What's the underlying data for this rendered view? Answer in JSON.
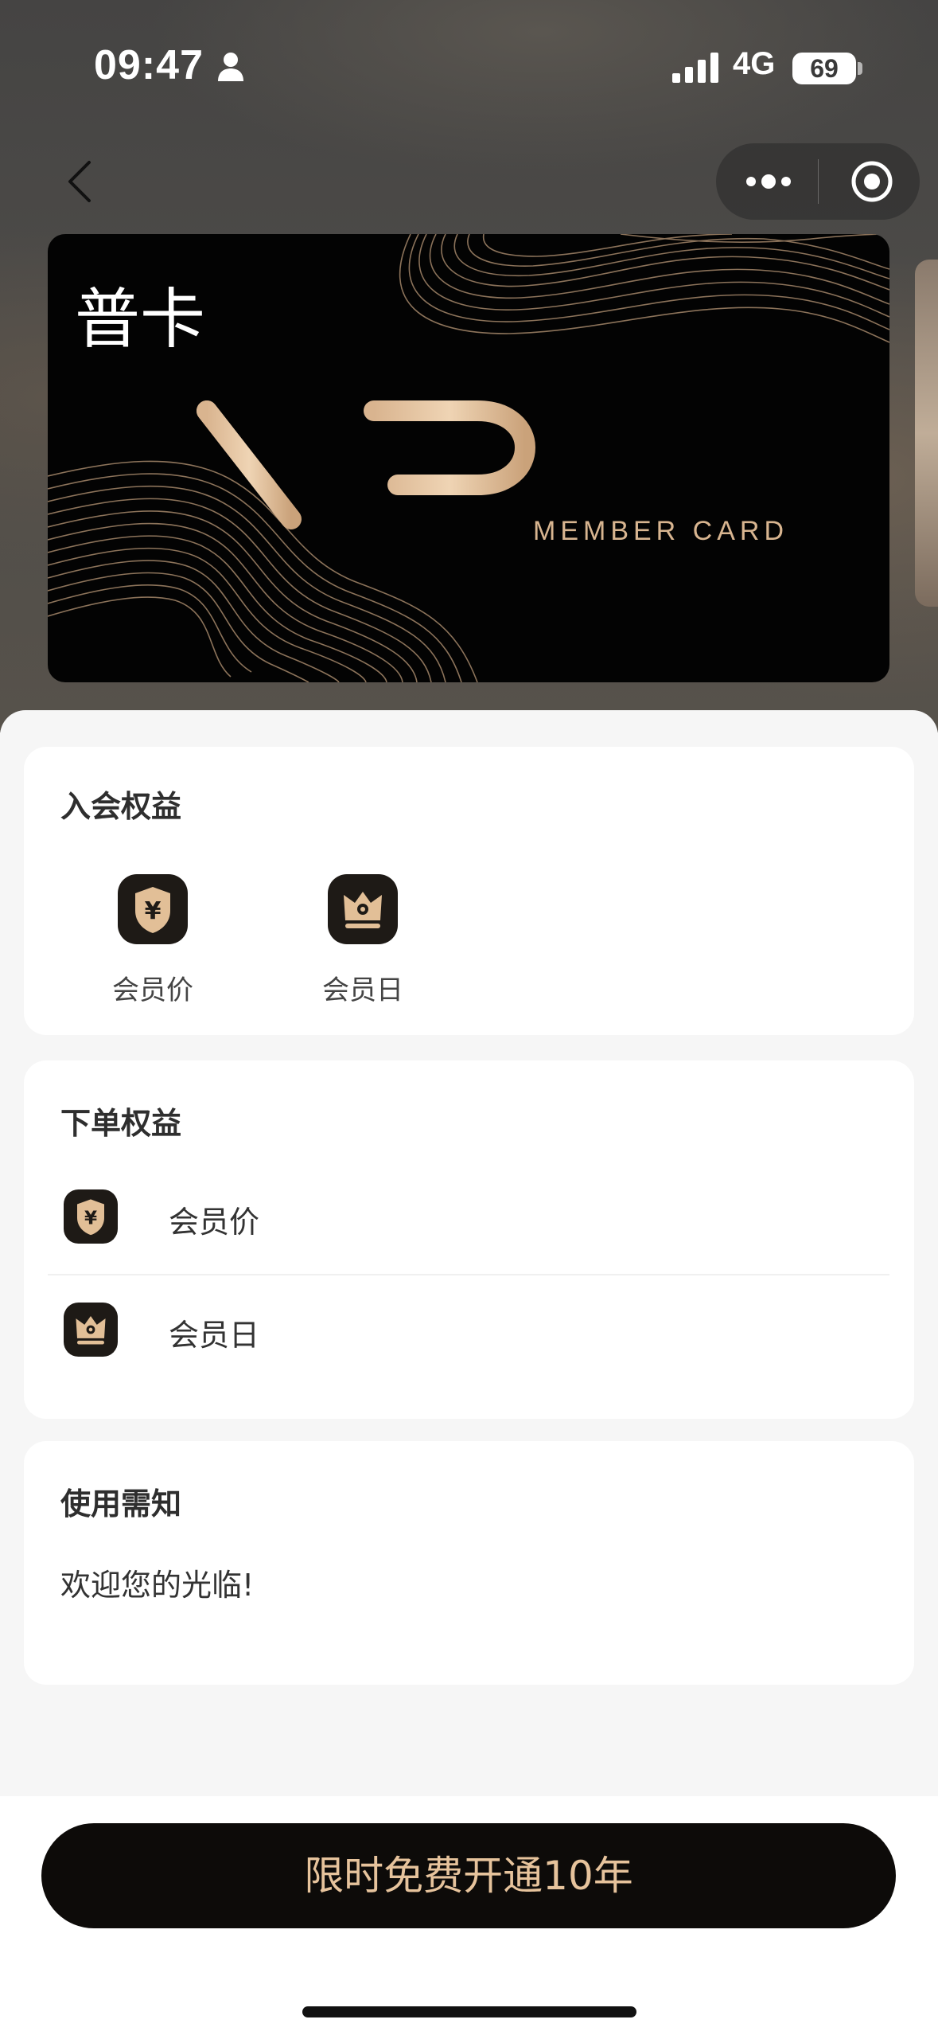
{
  "status_bar": {
    "time": "09:47",
    "network": "4G",
    "battery": "69"
  },
  "nav": {
    "back_icon": "chevron-left-icon",
    "more_icon": "more-dots-icon",
    "close_icon": "target-circle-icon"
  },
  "card": {
    "title": "普卡",
    "logo_text": "VIP",
    "subtitle": "MEMBER CARD"
  },
  "join_benefits": {
    "title": "入会权益",
    "items": [
      {
        "label": "会员价",
        "icon": "yen-shield-icon"
      },
      {
        "label": "会员日",
        "icon": "crown-icon"
      }
    ]
  },
  "order_benefits": {
    "title": "下单权益",
    "items": [
      {
        "label": "会员价",
        "icon": "yen-shield-icon"
      },
      {
        "label": "会员日",
        "icon": "crown-icon"
      }
    ]
  },
  "notice": {
    "title": "使用需知",
    "text": "欢迎您的光临!"
  },
  "cta": {
    "label": "限时免费开通10年"
  },
  "colors": {
    "gold": "#d8b590",
    "cta_text": "#e6c39c",
    "card_bg": "#030303",
    "icon_bg": "#1e1a16"
  }
}
